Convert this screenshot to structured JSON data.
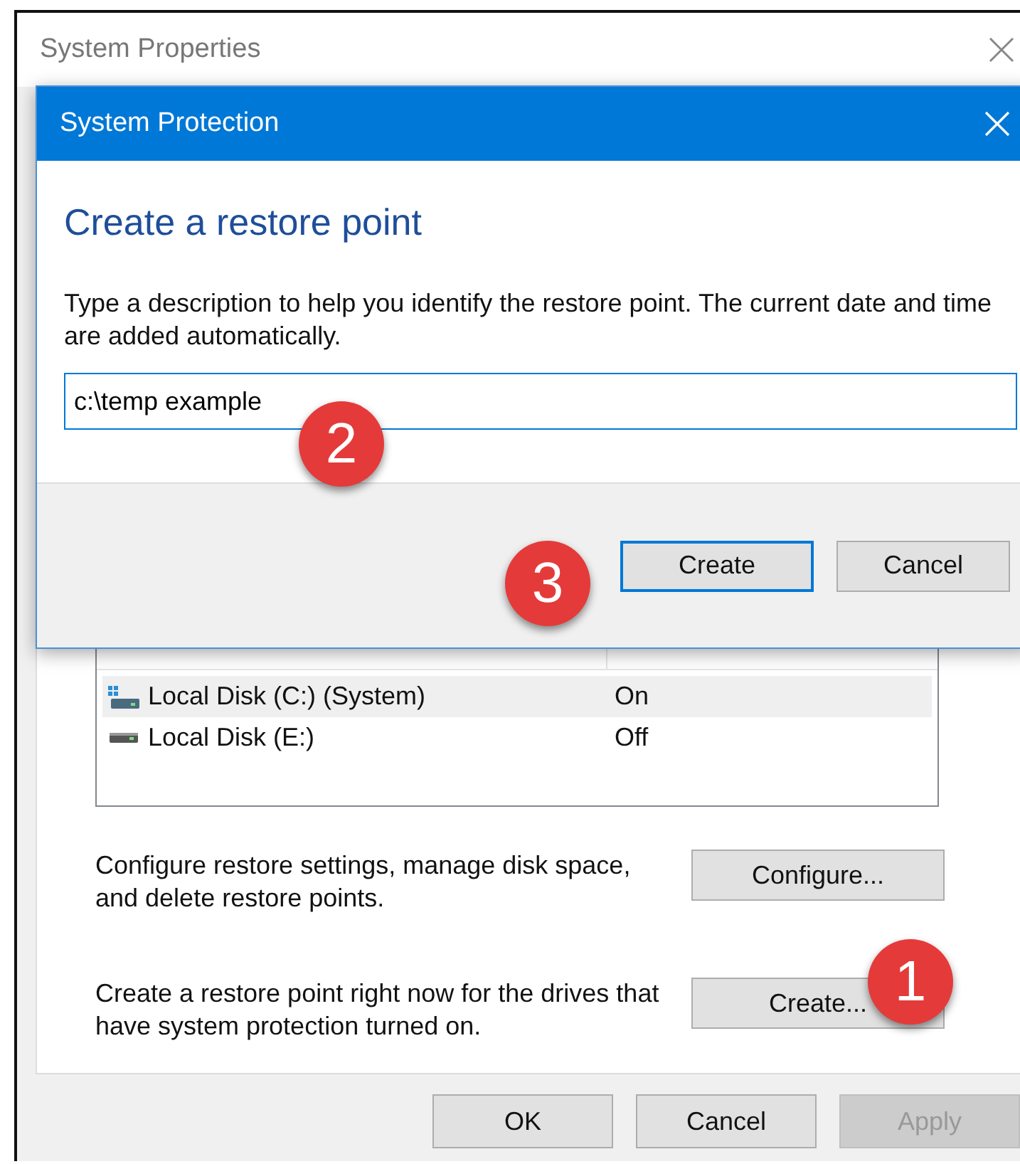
{
  "system_properties": {
    "title": "System Properties",
    "drives_list": {
      "rows": [
        {
          "name": "Local Disk (C:) (System)",
          "protection": "On",
          "kind": "system",
          "selected": true
        },
        {
          "name": "Local Disk (E:)",
          "protection": "Off",
          "kind": "data",
          "selected": false
        }
      ]
    },
    "actions": [
      {
        "description": "Configure restore settings, manage disk space, and delete restore points.",
        "button": "Configure..."
      },
      {
        "description": "Create a restore point right now for the drives that have system protection turned on.",
        "button": "Create..."
      }
    ],
    "buttons": [
      {
        "label": "OK",
        "disabled": false
      },
      {
        "label": "Cancel",
        "disabled": false
      },
      {
        "label": "Apply",
        "disabled": true
      }
    ]
  },
  "dialog": {
    "title": "System Protection",
    "heading": "Create a restore point",
    "instructions": "Type a description to help you identify the restore point. The current date and time are added automatically.",
    "description_field": {
      "value": "c:\\temp example"
    },
    "buttons": [
      {
        "label": "Create",
        "default": true
      },
      {
        "label": "Cancel",
        "default": false
      }
    ]
  },
  "callouts": [
    {
      "label": "1"
    },
    {
      "label": "2"
    },
    {
      "label": "3"
    }
  ]
}
